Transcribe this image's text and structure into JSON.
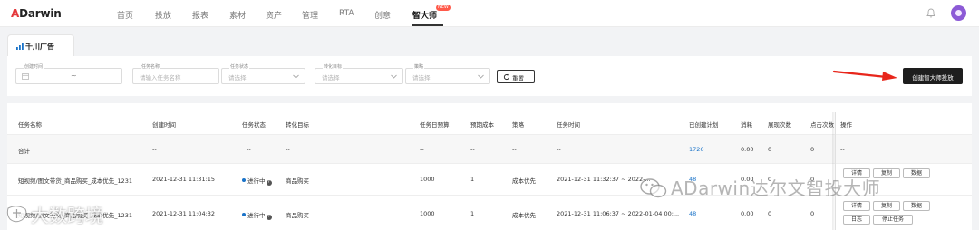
{
  "brand": {
    "text_a": "A",
    "text_rest": "Darwin"
  },
  "nav": {
    "items": [
      "首页",
      "投放",
      "报表",
      "素材",
      "资产",
      "管理",
      "RTA",
      "创意",
      "智大师"
    ],
    "active_index": 8,
    "new_badge": "NEW"
  },
  "tab": {
    "label": "千川广告"
  },
  "filters": {
    "created_time_label": "创建时间",
    "date_separator": "~",
    "task_name_label": "任务名称",
    "task_name_placeholder": "请输入任务名称",
    "task_status_label": "任务状态",
    "task_status_placeholder": "请选择",
    "target_label": "转化目标",
    "target_placeholder": "请选择",
    "strategy_label": "策略",
    "strategy_placeholder": "请选择",
    "reset_label": "重置",
    "create_label": "创建智大师投放"
  },
  "table": {
    "headers": [
      "任务名称",
      "创建时间",
      "任务状态",
      "转化目标",
      "任务日预算",
      "预期成本",
      "策略",
      "任务时间",
      "已创建计划",
      "消耗",
      "展现次数",
      "点击次数",
      "操作"
    ],
    "summary": {
      "name": "合计",
      "created": "--",
      "status": "--",
      "target": "--",
      "budget": "--",
      "cost": "--",
      "strategy": "--",
      "time": "--",
      "plans": "1726",
      "spend": "0.00",
      "impressions": "0",
      "clicks": "0",
      "ops": "--"
    },
    "rows": [
      {
        "name": "短视频/图文带货_商品购买_成本优先_1231",
        "created": "2021-12-31 11:31:15",
        "status": "进行中",
        "target": "商品购买",
        "budget": "1000",
        "cost": "1",
        "strategy": "成本优先",
        "time": "2021-12-31 11:32:37 ~ 2022-...",
        "plans": "48",
        "spend": "0.00",
        "impressions": "0",
        "clicks": "0",
        "ops": [
          "详情",
          "复制",
          "数据"
        ]
      },
      {
        "name": "短视频/图文带货_商品购买_成本优先_1231",
        "created": "2021-12-31 11:04:32",
        "status": "进行中",
        "target": "商品购买",
        "budget": "1000",
        "cost": "1",
        "strategy": "成本优先",
        "time": "2021-12-31 11:06:37 ~ 2022-01-04 00:...",
        "plans": "48",
        "spend": "0.00",
        "impressions": "0",
        "clicks": "0",
        "ops": [
          "详情",
          "复制",
          "数据",
          "日志",
          "停止任务"
        ]
      }
    ]
  },
  "watermarks": {
    "right": "ADarwin达尔文智投大师",
    "left": "大数跨境"
  },
  "colors": {
    "accent_link": "#1a73c8",
    "dark_button": "#1e1e1e",
    "arrow_red": "#e8261b",
    "avatar": "#8c5ad6",
    "new_badge": "#ff5a4a"
  }
}
